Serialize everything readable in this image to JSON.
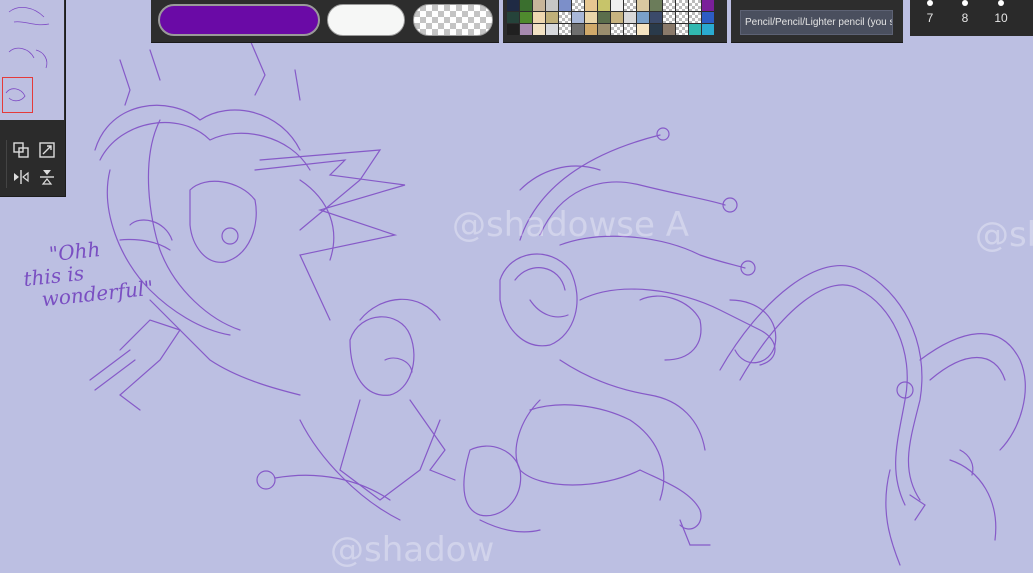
{
  "watermarks": [
    "@shadowse A",
    "@sh",
    "@shadow"
  ],
  "canvas_text": [
    "\"Ohh",
    "this is",
    "wonderful\""
  ],
  "colors": {
    "foreground": "#6a0aa6",
    "background": "#f6f7f6",
    "canvas": "#bcbfe2",
    "stroke": "#7d49c4"
  },
  "palette": [
    "#1f2a44",
    "#3a6f2e",
    "#c8b59a",
    "#c6c6c6",
    "#7c8fc9",
    "tr",
    "#e7c791",
    "#c7c46a",
    "#f0f0f0",
    "tr",
    "#d9c8a1",
    "#6b7c5a",
    "tr",
    "tr",
    "tr",
    "#7a1f9a",
    "#25433a",
    "#4f8a2e",
    "#efd8b0",
    "#c0b07a",
    "tr",
    "#a8b7d8",
    "#e9d5aa",
    "#5a6e4c",
    "#c7b380",
    "#d9d9d9",
    "#7aa0c8",
    "#3b4a6a",
    "tr",
    "tr",
    "tr",
    "#2d5cc4",
    "#202020",
    "#a78ab0",
    "#f2e2c4",
    "#d7d9dd",
    "tr",
    "#6f6f6f",
    "#d0a96a",
    "#9a8d6e",
    "tr",
    "tr",
    "#f5e3c0",
    "#2a3a4a",
    "#8a7a6a",
    "tr",
    "#31b8b0",
    "#2aaad0"
  ],
  "brush": {
    "name": "Pencil/Pencil/Lighter pencil (you sk"
  },
  "brush_sizes": [
    "7",
    "8",
    "10"
  ],
  "icons": {
    "layer_copy": "copy-icon",
    "fit": "fit-icon",
    "flip_h": "flip-horizontal-icon",
    "flip_v": "flip-vertical-icon"
  }
}
